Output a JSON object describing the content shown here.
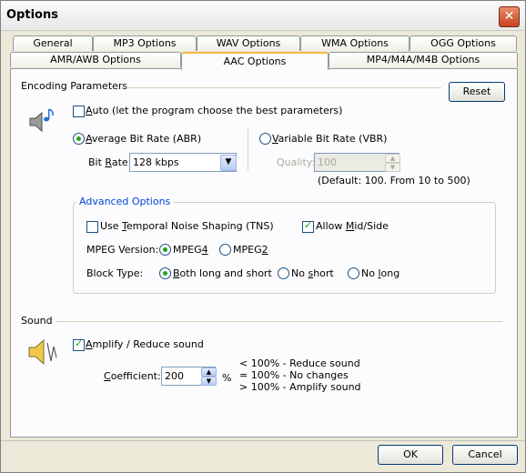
{
  "window": {
    "title": "Options",
    "close_label": "✕"
  },
  "tabs_back": [
    "General",
    "MP3 Options",
    "WAV Options",
    "WMA Options",
    "OGG Options"
  ],
  "tabs_front": [
    "AMR/AWB Options",
    "AAC Options",
    "MP4/M4A/M4B Options"
  ],
  "encoding": {
    "section_label": "Encoding Parameters",
    "reset_label": "Reset",
    "auto_label_pre": "A",
    "auto_label_post": "uto (let the program choose the best parameters)",
    "abr_label_pre": "A",
    "abr_label_post": "verage Bit Rate (ABR)",
    "vbr_label_pre": "V",
    "vbr_label_post": "ariable Bit Rate (VBR)",
    "bitrate_label_pre": "Bit ",
    "bitrate_label_u": "R",
    "bitrate_label_post": "ate:",
    "bitrate_value": "128 kbps",
    "quality_label": "Quality:",
    "quality_value": "100",
    "quality_note": "(Default: 100. From 10 to 500)"
  },
  "advanced": {
    "legend": "Advanced Options",
    "tns_label_pre": "Use ",
    "tns_label_u": "T",
    "tns_label_post": "emporal Noise Shaping (TNS)",
    "midside_label_pre": "Allow ",
    "midside_label_u": "M",
    "midside_label_post": "id/Side",
    "mpeg_label": "MPEG Version:",
    "mpeg4_pre": "MPEG",
    "mpeg4_u": "4",
    "mpeg2_pre": "MPEG",
    "mpeg2_u": "2",
    "block_label": "Block Type:",
    "both_u": "B",
    "both_post": "oth long and short",
    "noshort_pre": "No ",
    "noshort_u": "s",
    "noshort_post": "hort",
    "nolong_pre": "No ",
    "nolong_u": "l",
    "nolong_post": "ong"
  },
  "sound": {
    "section_label": "Sound",
    "amplify_u": "A",
    "amplify_post": "mplify / Reduce sound",
    "coef_u": "C",
    "coef_post": "oefficient:",
    "coef_value": "200",
    "percent": "%",
    "note_line1": "< 100% - Reduce sound",
    "note_line2": "= 100% - No changes",
    "note_line3": "> 100% - Amplify sound"
  },
  "footer": {
    "ok_label": "OK",
    "cancel_label": "Cancel"
  }
}
